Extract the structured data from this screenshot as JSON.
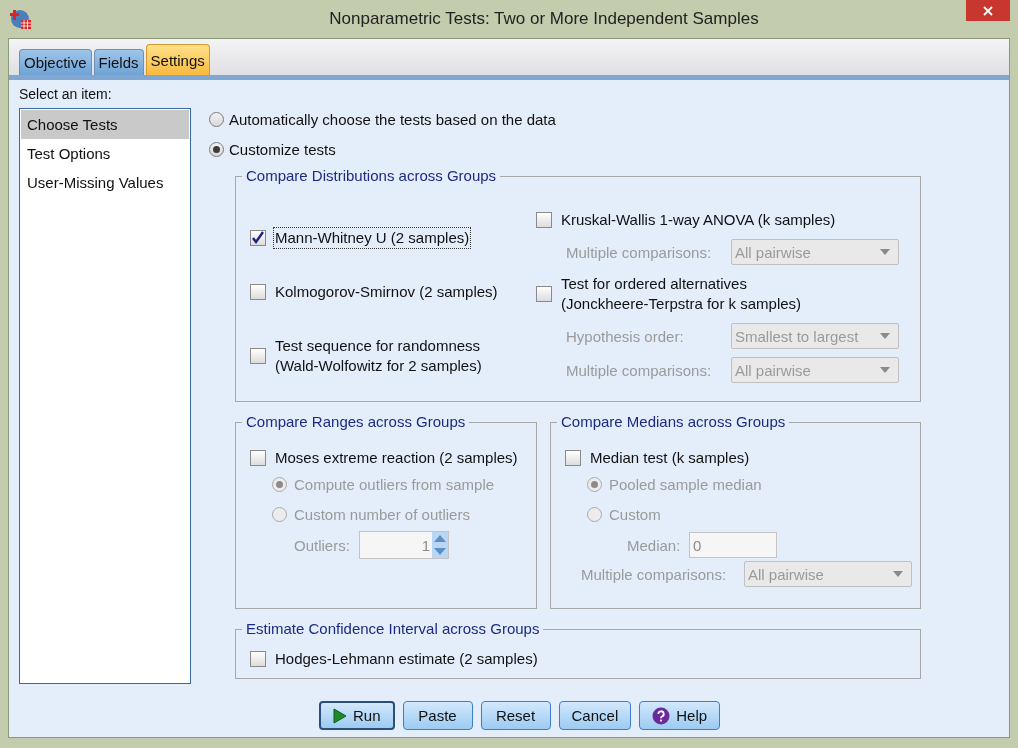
{
  "window": {
    "title": "Nonparametric Tests: Two or More Independent Samples"
  },
  "tabs": [
    {
      "label": "Objective",
      "selected": false
    },
    {
      "label": "Fields",
      "selected": false
    },
    {
      "label": "Settings",
      "selected": true
    }
  ],
  "item_list": {
    "label": "Select an item:",
    "items": [
      {
        "label": "Choose Tests",
        "selected": true
      },
      {
        "label": "Test Options",
        "selected": false
      },
      {
        "label": "User-Missing Values",
        "selected": false
      }
    ]
  },
  "test_mode": [
    {
      "label": "Automatically choose the tests based on the data",
      "selected": false
    },
    {
      "label": "Customize tests",
      "selected": true
    }
  ],
  "group_rows": [
    [
      {
        "title": "Compare Distributions across Groups",
        "columns": [
          [
            {
              "kind": "checkbox",
              "label": "Mann-Whitney U (2 samples)",
              "checked": true,
              "focused": true
            },
            {
              "kind": "checkbox",
              "label": "Kolmogorov-Smirnov (2 samples)",
              "checked": false,
              "focused": false
            },
            {
              "kind": "checkbox",
              "label": "Test sequence for randomness\n(Wald-Wolfowitz for 2 samples)",
              "checked": false,
              "focused": false
            }
          ],
          [
            {
              "kind": "checkbox",
              "label": "Kruskal-Wallis 1-way ANOVA (k samples)",
              "checked": false,
              "focused": false
            },
            {
              "kind": "dropdown",
              "label": "Multiple comparisons:",
              "value": "All pairwise",
              "disabled": true
            },
            {
              "kind": "checkbox",
              "label": "Test for ordered alternatives\n(Jonckheere-Terpstra for k samples)",
              "checked": false,
              "focused": false
            },
            {
              "kind": "dropdown",
              "label": "Hypothesis order:",
              "value": "Smallest to largest",
              "disabled": true
            },
            {
              "kind": "dropdown",
              "label": "Multiple comparisons:",
              "value": "All pairwise",
              "disabled": true
            }
          ]
        ]
      }
    ],
    [
      {
        "title": "Compare Ranges across Groups",
        "columns": [
          [
            {
              "kind": "checkbox",
              "label": "Moses extreme reaction (2 samples)",
              "checked": false,
              "focused": false
            },
            {
              "kind": "radio",
              "label": "Compute outliers from sample",
              "selected": true,
              "disabled": true
            },
            {
              "kind": "radio",
              "label": "Custom number of outliers",
              "selected": false,
              "disabled": true
            },
            {
              "kind": "spinner",
              "label": "Outliers:",
              "value": "1",
              "disabled": true
            }
          ]
        ]
      },
      {
        "title": "Compare Medians across Groups",
        "columns": [
          [
            {
              "kind": "checkbox",
              "label": "Median test (k samples)",
              "checked": false,
              "focused": false
            },
            {
              "kind": "radio",
              "label": "Pooled sample median",
              "selected": true,
              "disabled": true
            },
            {
              "kind": "radio",
              "label": "Custom",
              "selected": false,
              "disabled": true
            },
            {
              "kind": "text",
              "label": "Median:",
              "value": "0",
              "disabled": true
            },
            {
              "kind": "dropdown",
              "label": "Multiple comparisons:",
              "value": "All pairwise",
              "disabled": true
            }
          ]
        ]
      }
    ],
    [
      {
        "title": "Estimate Confidence Interval across Groups",
        "columns": [
          [
            {
              "kind": "checkbox",
              "label": "Hodges-Lehmann estimate (2 samples)",
              "checked": false,
              "focused": false
            }
          ]
        ]
      }
    ]
  ],
  "buttons": [
    {
      "label": "Run",
      "kind": "play",
      "default": true
    },
    {
      "label": "Paste",
      "kind": "plain",
      "default": false
    },
    {
      "label": "Reset",
      "kind": "plain",
      "default": false
    },
    {
      "label": "Cancel",
      "kind": "plain",
      "default": false
    },
    {
      "label": "Help",
      "kind": "help",
      "default": false
    }
  ]
}
